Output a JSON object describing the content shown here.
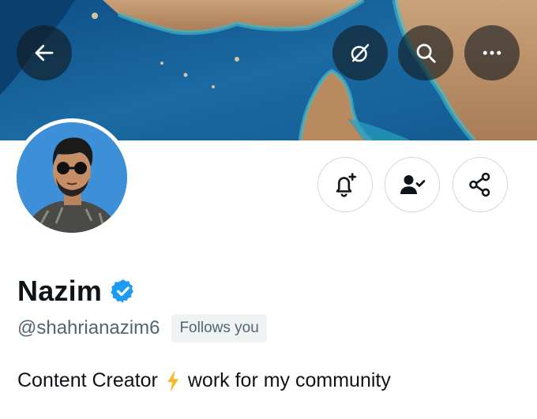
{
  "header": {
    "back_icon": "arrow-left-icon",
    "grok_icon": "slashed-circle-icon",
    "search_icon": "search-icon",
    "more_icon": "more-horizontal-icon"
  },
  "profile": {
    "name": "Nazim",
    "handle": "@shahrianazim6",
    "follows_badge": "Follows you",
    "bio_before": "Content Creator",
    "bio_emoji": "high-voltage-icon",
    "bio_after": "work for my community",
    "verified": true,
    "verified_color": "#1d9bf0"
  },
  "actions": {
    "notify_icon": "bell-plus-icon",
    "following_icon": "person-check-icon",
    "share_icon": "share-icon"
  },
  "colors": {
    "secondary_text": "#536471",
    "badge_bg": "#eff3f4",
    "sea": "#1d5d8c"
  }
}
